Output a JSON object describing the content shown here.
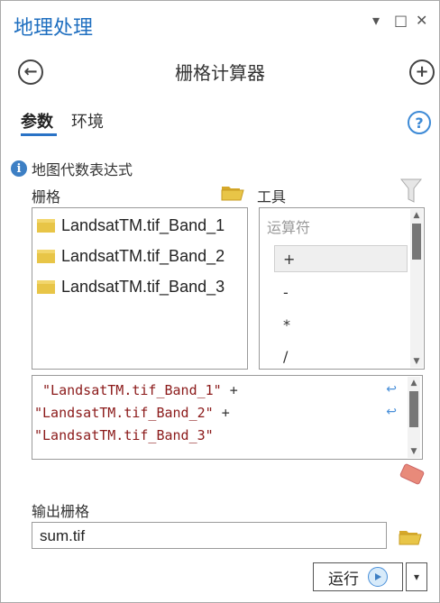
{
  "pane": {
    "title": "地理处理",
    "menu_icon": "▾",
    "restore_icon": "□",
    "close_icon": "✕"
  },
  "header": {
    "title": "栅格计算器",
    "back_icon": "←",
    "add_icon": "+"
  },
  "tabs": [
    {
      "label": "参数",
      "active": true
    },
    {
      "label": "环境",
      "active": false
    }
  ],
  "help_icon": "?",
  "map_algebra": {
    "label": "地图代数表达式",
    "rasters_label": "栅格",
    "tools_label": "工具",
    "rasters": [
      "LandsatTM.tif_Band_1",
      "LandsatTM.tif_Band_2",
      "LandsatTM.tif_Band_3"
    ],
    "operators_header": "运算符",
    "operators": [
      "+",
      "-",
      "*",
      "/"
    ],
    "selected_operator": "+",
    "expression_lines": [
      {
        "text": " \"LandsatTM.tif_Band_1\"",
        "plus": " +",
        "wrap": true
      },
      {
        "text": "\"LandsatTM.tif_Band_2\"",
        "plus": " +",
        "wrap": true
      },
      {
        "text": "\"LandsatTM.tif_Band_3\"",
        "plus": "",
        "wrap": false
      }
    ]
  },
  "output": {
    "label": "输出栅格",
    "value": "sum.tif"
  },
  "run": {
    "label": "运行",
    "dropdown_icon": "▾"
  },
  "colors": {
    "accent": "#1f6fc0",
    "folder": "#e8c547",
    "expression_text": "#8b1a1a"
  }
}
